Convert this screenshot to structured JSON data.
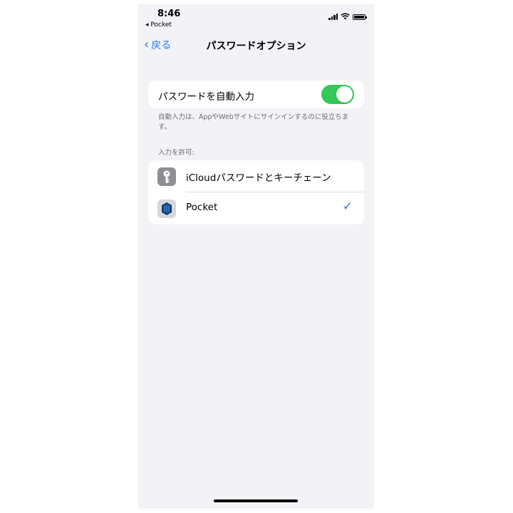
{
  "status_bar": {
    "time": "8:46",
    "back_app": "◂ Pocket"
  },
  "nav": {
    "back_label": "戻る",
    "title": "パスワードオプション"
  },
  "autofill": {
    "label": "パスワードを自動入力",
    "enabled": true,
    "accent_color": "#34c759"
  },
  "footnote": "自動入力は、AppやWebサイトにサインインするのに役立ちます。",
  "allow_section": {
    "header": "入力を許可:",
    "items": [
      {
        "label": "iCloudパスワードとキーチェーン",
        "icon": "key-icon",
        "selected": false
      },
      {
        "label": "Pocket",
        "icon": "pocket-app-icon",
        "selected": true
      }
    ],
    "check": "✓"
  },
  "colors": {
    "link": "#2f7be6",
    "background": "#f2f2f7"
  }
}
